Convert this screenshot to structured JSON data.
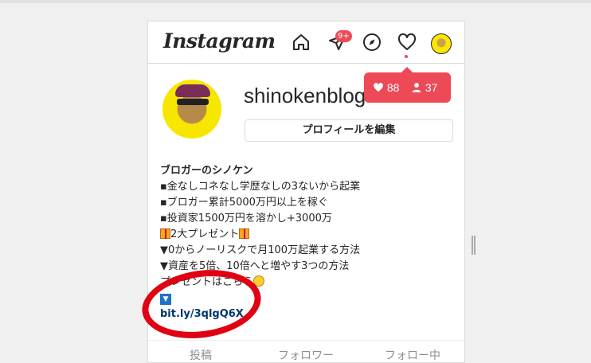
{
  "topbar": {
    "logo": "Instagram",
    "messages_badge": "9+",
    "icons": [
      "home-icon",
      "direct-message-icon",
      "explore-icon",
      "activity-heart-icon",
      "profile-avatar"
    ]
  },
  "activity_popup": {
    "likes": "88",
    "followers": "37"
  },
  "profile": {
    "username": "shinokenblog",
    "edit_button": "プロフィールを編集"
  },
  "bio": {
    "name": "ブロガーのシノケン",
    "line1": "▪金なしコネなし学歴なしの3ないから起業",
    "line2": "▪ブロガー累計5000万円以上を稼ぐ",
    "line3": "▪投資家1500万円を溶かし+3000万",
    "line4": "2大プレゼント",
    "line5": "▼0からノーリスクで月100万起業する方法",
    "line6": "▼資産を5倍、10倍へと増やす3つの方法",
    "line7": "プレゼントはこちら",
    "down_arrow": "▼",
    "link": "bit.ly/3qlgQ6X"
  },
  "tabs": [
    "投稿",
    "フォロワー",
    "フォロー中"
  ],
  "colors": {
    "accent": "#ed4956",
    "link": "#00376b",
    "annotation": "#e00012"
  }
}
